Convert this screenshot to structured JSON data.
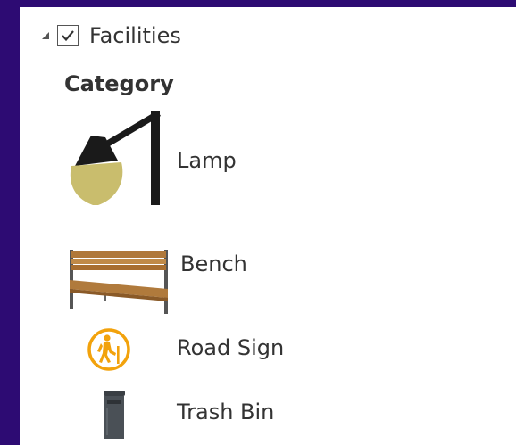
{
  "layer": {
    "name": "Facilities",
    "checked": true,
    "expanded": true
  },
  "legend": {
    "heading": "Category",
    "items": [
      {
        "label": "Lamp",
        "icon": "street-lamp-icon"
      },
      {
        "label": "Bench",
        "icon": "bench-icon"
      },
      {
        "label": "Road Sign",
        "icon": "hiker-sign-icon"
      },
      {
        "label": "Trash Bin",
        "icon": "trash-bin-icon"
      }
    ]
  },
  "colors": {
    "background": "#2d0b73",
    "panel": "#ffffff",
    "text": "#333333",
    "sign_orange": "#f2a20c",
    "lamp_globe": "#c9bd6d",
    "bench_wood": "#b0783a"
  }
}
